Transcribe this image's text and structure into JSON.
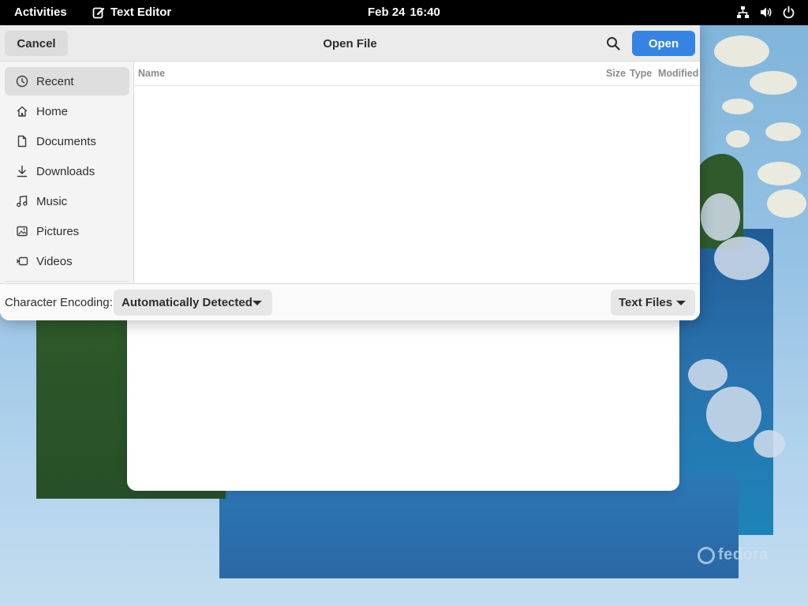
{
  "topbar": {
    "activities": "Activities",
    "app_name": "Text Editor",
    "date": "Feb 24",
    "time": "16:40",
    "status_icons": [
      "network-icon",
      "volume-icon",
      "power-icon"
    ]
  },
  "dialog": {
    "title": "Open File",
    "cancel_label": "Cancel",
    "open_label": "Open",
    "accent_color": "#3584e4"
  },
  "sidebar": {
    "items": [
      {
        "label": "Recent",
        "icon": "clock-icon",
        "active": true
      },
      {
        "label": "Home",
        "icon": "home-icon"
      },
      {
        "label": "Documents",
        "icon": "document-icon"
      },
      {
        "label": "Downloads",
        "icon": "download-icon"
      },
      {
        "label": "Music",
        "icon": "music-icon"
      },
      {
        "label": "Pictures",
        "icon": "picture-icon"
      },
      {
        "label": "Videos",
        "icon": "video-icon"
      }
    ]
  },
  "filelist": {
    "columns": [
      "Name",
      "Size",
      "Type",
      "Modified"
    ],
    "rows": []
  },
  "footer": {
    "encoding_label": "Character Encoding:",
    "encoding_value": "Automatically Detected",
    "filter_value": "Text Files"
  },
  "wallpaper": {
    "brand": "fedora"
  }
}
